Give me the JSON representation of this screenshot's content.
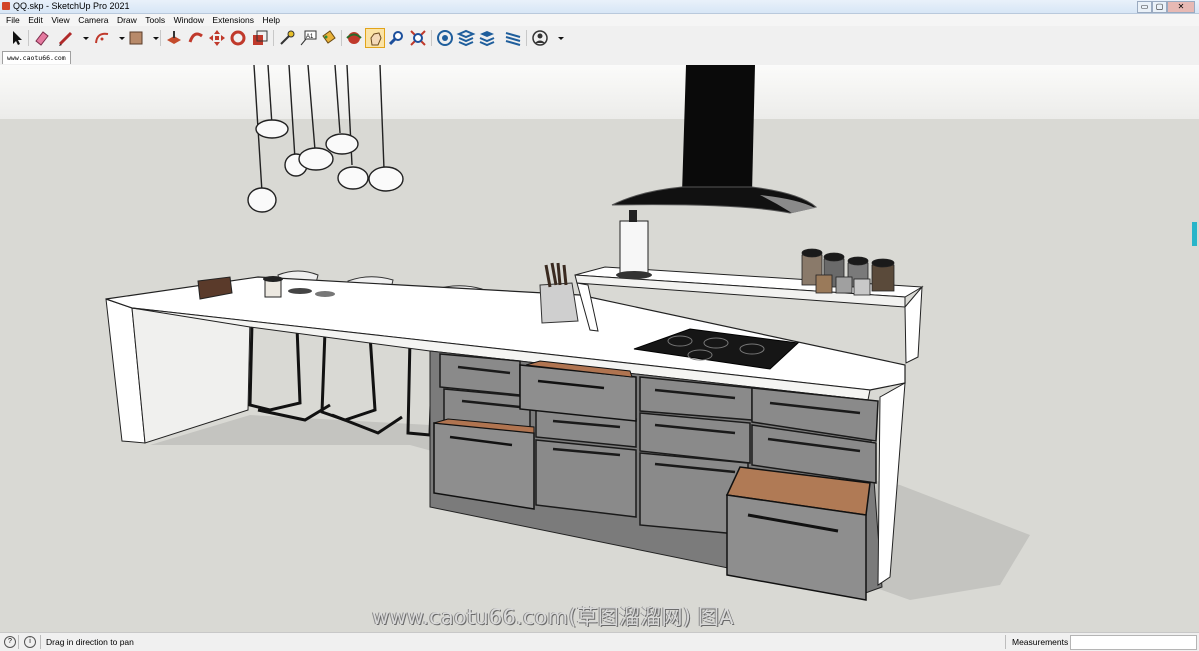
{
  "window": {
    "title": "QQ.skp - SketchUp Pro 2021",
    "min": "▭",
    "max": "▢",
    "close": "✕"
  },
  "menu": [
    "File",
    "Edit",
    "View",
    "Camera",
    "Draw",
    "Tools",
    "Window",
    "Extensions",
    "Help"
  ],
  "toolbar": {
    "tools": [
      "select",
      "eraser",
      "line",
      "arc",
      "shape",
      "push-pull",
      "follow-me",
      "move",
      "rotate",
      "scale",
      "tape-measure",
      "text",
      "paint-bucket",
      "orbit",
      "pan",
      "zoom",
      "zoom-extents",
      "3d-warehouse",
      "extension-warehouse",
      "layout",
      "sandbox",
      "account"
    ],
    "active_tool": "pan"
  },
  "scene_tab": {
    "label": "www.caotu66.com"
  },
  "viewport": {
    "sky_color": "#f2f2f1",
    "ground_color": "#d9d9d4"
  },
  "watermark": "www.caotu66.com(草图溜溜网) 图A",
  "status": {
    "message": "Drag in direction to pan",
    "measurements_label": "Measurements",
    "measurements_value": ""
  }
}
